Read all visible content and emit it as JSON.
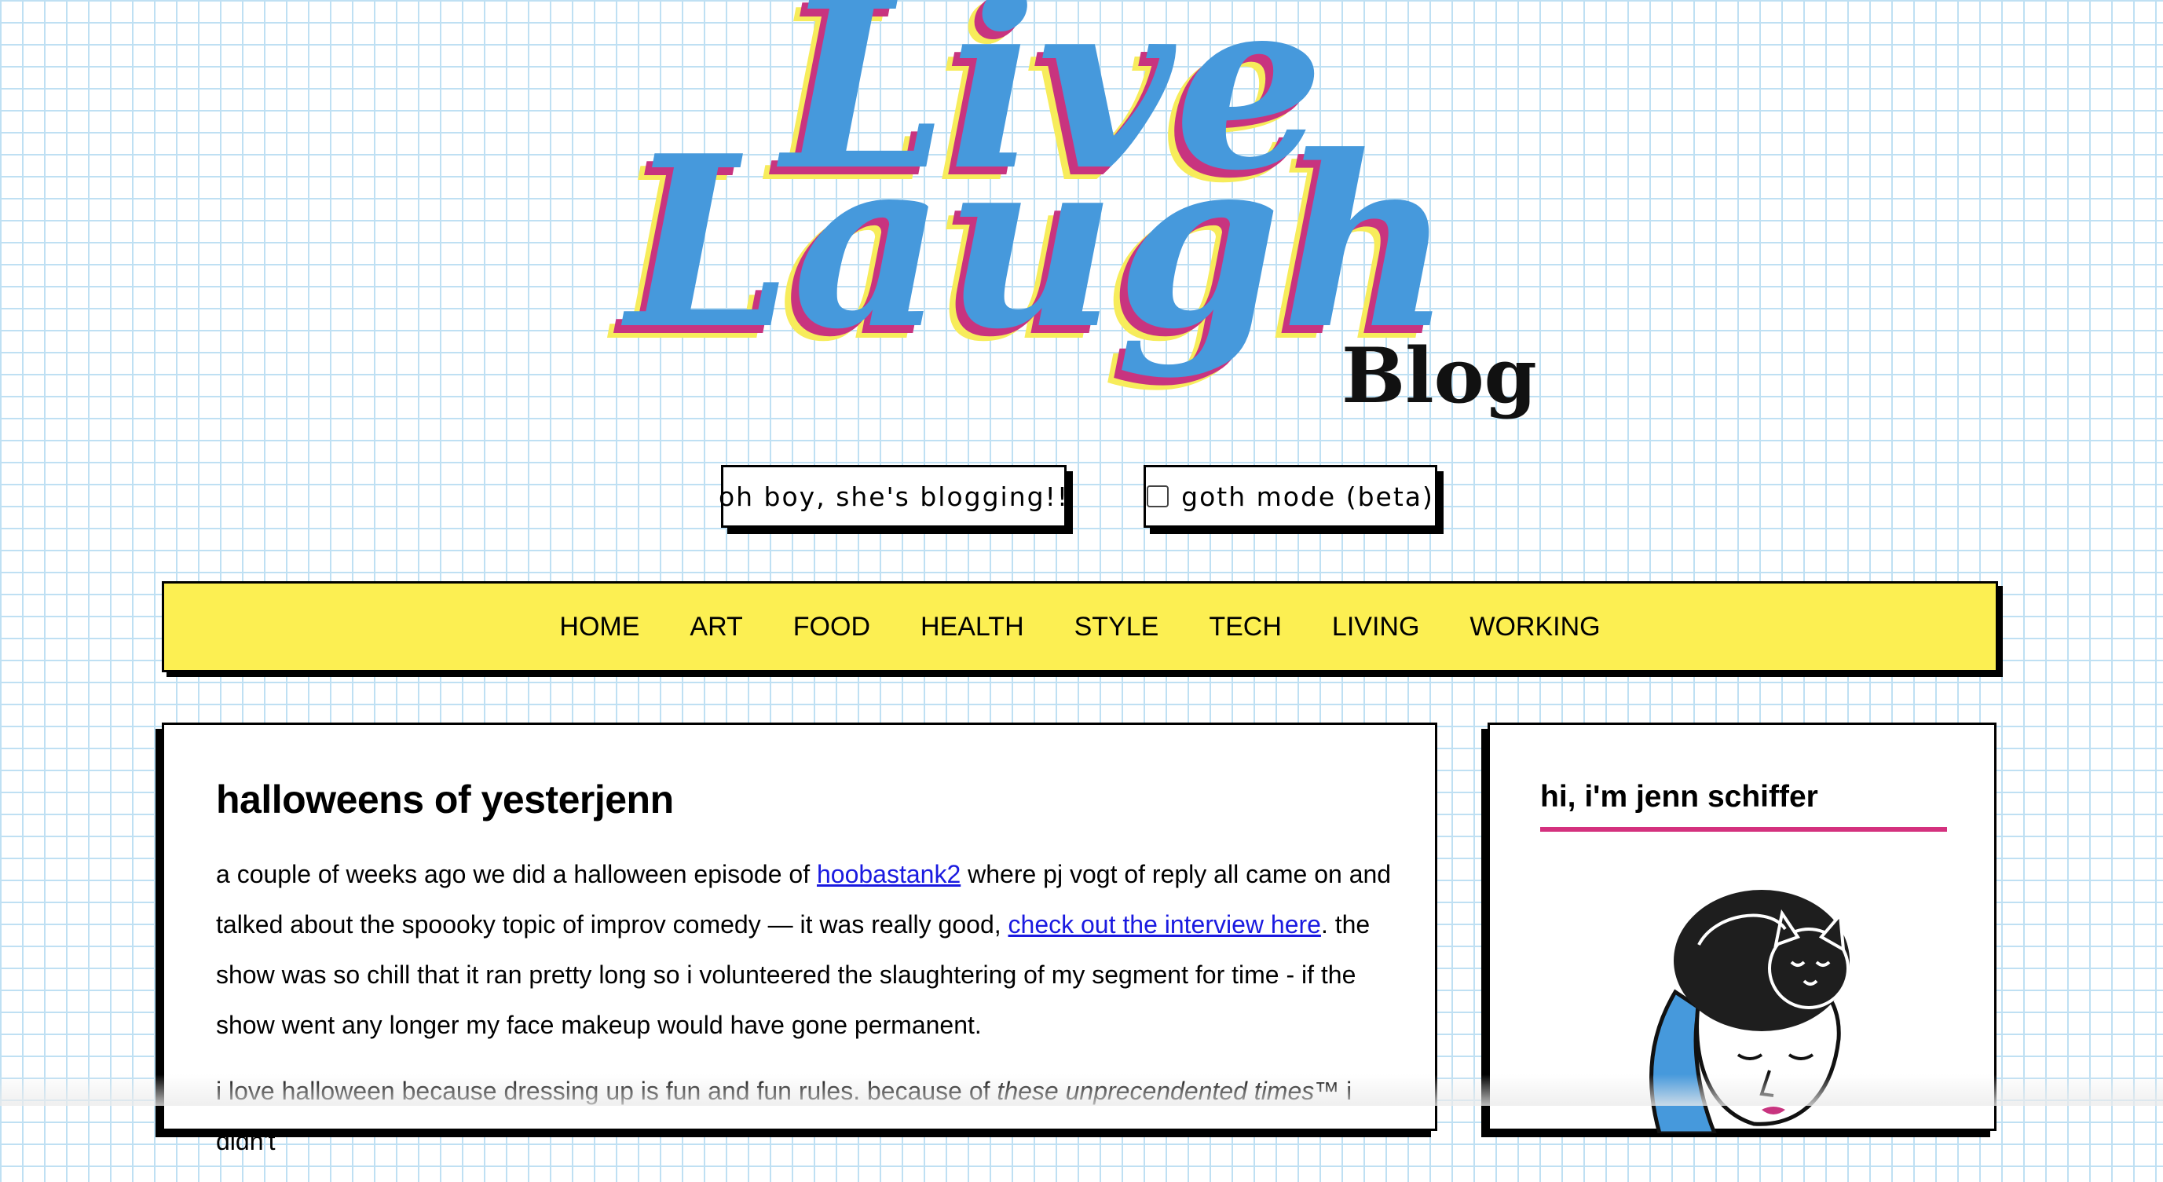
{
  "logo": {
    "line1": "Live",
    "line2": "Laugh",
    "line3": "Blog",
    "colors": {
      "primary": "#4699dc",
      "shadow_pink": "#c8347f",
      "shadow_yellow": "#f7ec5b",
      "blog_text": "#111111"
    }
  },
  "buttons": {
    "tagline": "oh boy, she's blogging!!",
    "goth_toggle": "goth mode (beta)",
    "goth_checked": false
  },
  "nav": {
    "items": [
      "HOME",
      "ART",
      "FOOD",
      "HEALTH",
      "STYLE",
      "TECH",
      "LIVING",
      "WORKING"
    ],
    "background": "#fcef52"
  },
  "post": {
    "title": "halloweens of yesterjenn",
    "p1_a": "a couple of weeks ago we did a halloween episode of ",
    "p1_link1": "hoobastank2",
    "p1_b": " where pj vogt of reply all came on and talked about the spoooky topic of improv comedy — it was really good, ",
    "p1_link2": "check out the interview here",
    "p1_c": ". the show was so chill that it ran pretty long so i volunteered the slaughtering of my segment for time - if the show went any longer my face makeup would have gone permanent.",
    "p2_a": "i love halloween because dressing up is fun and fun rules. because of ",
    "p2_em": "these unprecendented times™",
    "p2_b": " i didn't"
  },
  "sidebar": {
    "title": "hi, i'm jenn schiffer",
    "rule_color": "#d4317e",
    "portrait_icon": "portrait-with-cat-icon"
  }
}
